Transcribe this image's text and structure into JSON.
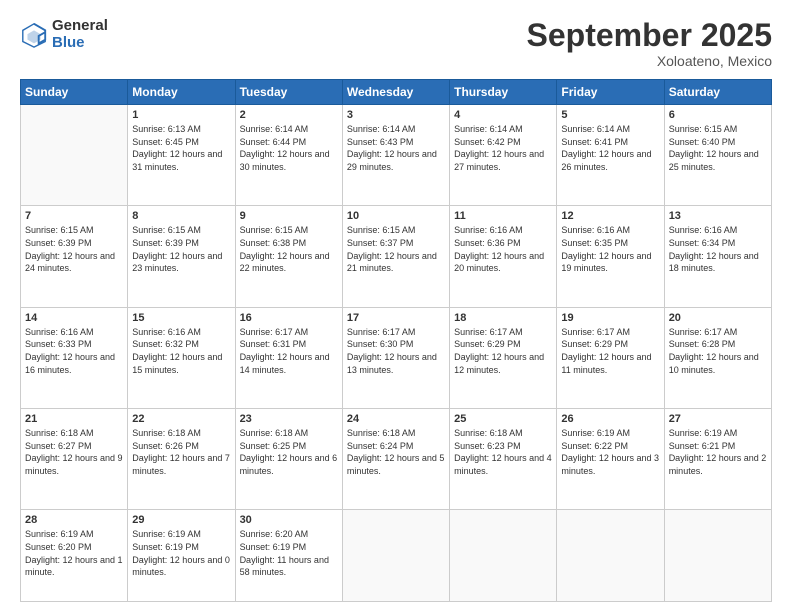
{
  "header": {
    "logo_general": "General",
    "logo_blue": "Blue",
    "month_title": "September 2025",
    "subtitle": "Xoloateno, Mexico"
  },
  "days_of_week": [
    "Sunday",
    "Monday",
    "Tuesday",
    "Wednesday",
    "Thursday",
    "Friday",
    "Saturday"
  ],
  "weeks": [
    [
      {
        "num": "",
        "info": ""
      },
      {
        "num": "1",
        "info": "Sunrise: 6:13 AM\nSunset: 6:45 PM\nDaylight: 12 hours\nand 31 minutes."
      },
      {
        "num": "2",
        "info": "Sunrise: 6:14 AM\nSunset: 6:44 PM\nDaylight: 12 hours\nand 30 minutes."
      },
      {
        "num": "3",
        "info": "Sunrise: 6:14 AM\nSunset: 6:43 PM\nDaylight: 12 hours\nand 29 minutes."
      },
      {
        "num": "4",
        "info": "Sunrise: 6:14 AM\nSunset: 6:42 PM\nDaylight: 12 hours\nand 27 minutes."
      },
      {
        "num": "5",
        "info": "Sunrise: 6:14 AM\nSunset: 6:41 PM\nDaylight: 12 hours\nand 26 minutes."
      },
      {
        "num": "6",
        "info": "Sunrise: 6:15 AM\nSunset: 6:40 PM\nDaylight: 12 hours\nand 25 minutes."
      }
    ],
    [
      {
        "num": "7",
        "info": "Sunrise: 6:15 AM\nSunset: 6:39 PM\nDaylight: 12 hours\nand 24 minutes."
      },
      {
        "num": "8",
        "info": "Sunrise: 6:15 AM\nSunset: 6:39 PM\nDaylight: 12 hours\nand 23 minutes."
      },
      {
        "num": "9",
        "info": "Sunrise: 6:15 AM\nSunset: 6:38 PM\nDaylight: 12 hours\nand 22 minutes."
      },
      {
        "num": "10",
        "info": "Sunrise: 6:15 AM\nSunset: 6:37 PM\nDaylight: 12 hours\nand 21 minutes."
      },
      {
        "num": "11",
        "info": "Sunrise: 6:16 AM\nSunset: 6:36 PM\nDaylight: 12 hours\nand 20 minutes."
      },
      {
        "num": "12",
        "info": "Sunrise: 6:16 AM\nSunset: 6:35 PM\nDaylight: 12 hours\nand 19 minutes."
      },
      {
        "num": "13",
        "info": "Sunrise: 6:16 AM\nSunset: 6:34 PM\nDaylight: 12 hours\nand 18 minutes."
      }
    ],
    [
      {
        "num": "14",
        "info": "Sunrise: 6:16 AM\nSunset: 6:33 PM\nDaylight: 12 hours\nand 16 minutes."
      },
      {
        "num": "15",
        "info": "Sunrise: 6:16 AM\nSunset: 6:32 PM\nDaylight: 12 hours\nand 15 minutes."
      },
      {
        "num": "16",
        "info": "Sunrise: 6:17 AM\nSunset: 6:31 PM\nDaylight: 12 hours\nand 14 minutes."
      },
      {
        "num": "17",
        "info": "Sunrise: 6:17 AM\nSunset: 6:30 PM\nDaylight: 12 hours\nand 13 minutes."
      },
      {
        "num": "18",
        "info": "Sunrise: 6:17 AM\nSunset: 6:29 PM\nDaylight: 12 hours\nand 12 minutes."
      },
      {
        "num": "19",
        "info": "Sunrise: 6:17 AM\nSunset: 6:29 PM\nDaylight: 12 hours\nand 11 minutes."
      },
      {
        "num": "20",
        "info": "Sunrise: 6:17 AM\nSunset: 6:28 PM\nDaylight: 12 hours\nand 10 minutes."
      }
    ],
    [
      {
        "num": "21",
        "info": "Sunrise: 6:18 AM\nSunset: 6:27 PM\nDaylight: 12 hours\nand 9 minutes."
      },
      {
        "num": "22",
        "info": "Sunrise: 6:18 AM\nSunset: 6:26 PM\nDaylight: 12 hours\nand 7 minutes."
      },
      {
        "num": "23",
        "info": "Sunrise: 6:18 AM\nSunset: 6:25 PM\nDaylight: 12 hours\nand 6 minutes."
      },
      {
        "num": "24",
        "info": "Sunrise: 6:18 AM\nSunset: 6:24 PM\nDaylight: 12 hours\nand 5 minutes."
      },
      {
        "num": "25",
        "info": "Sunrise: 6:18 AM\nSunset: 6:23 PM\nDaylight: 12 hours\nand 4 minutes."
      },
      {
        "num": "26",
        "info": "Sunrise: 6:19 AM\nSunset: 6:22 PM\nDaylight: 12 hours\nand 3 minutes."
      },
      {
        "num": "27",
        "info": "Sunrise: 6:19 AM\nSunset: 6:21 PM\nDaylight: 12 hours\nand 2 minutes."
      }
    ],
    [
      {
        "num": "28",
        "info": "Sunrise: 6:19 AM\nSunset: 6:20 PM\nDaylight: 12 hours\nand 1 minute."
      },
      {
        "num": "29",
        "info": "Sunrise: 6:19 AM\nSunset: 6:19 PM\nDaylight: 12 hours\nand 0 minutes."
      },
      {
        "num": "30",
        "info": "Sunrise: 6:20 AM\nSunset: 6:19 PM\nDaylight: 11 hours\nand 58 minutes."
      },
      {
        "num": "",
        "info": ""
      },
      {
        "num": "",
        "info": ""
      },
      {
        "num": "",
        "info": ""
      },
      {
        "num": "",
        "info": ""
      }
    ]
  ]
}
